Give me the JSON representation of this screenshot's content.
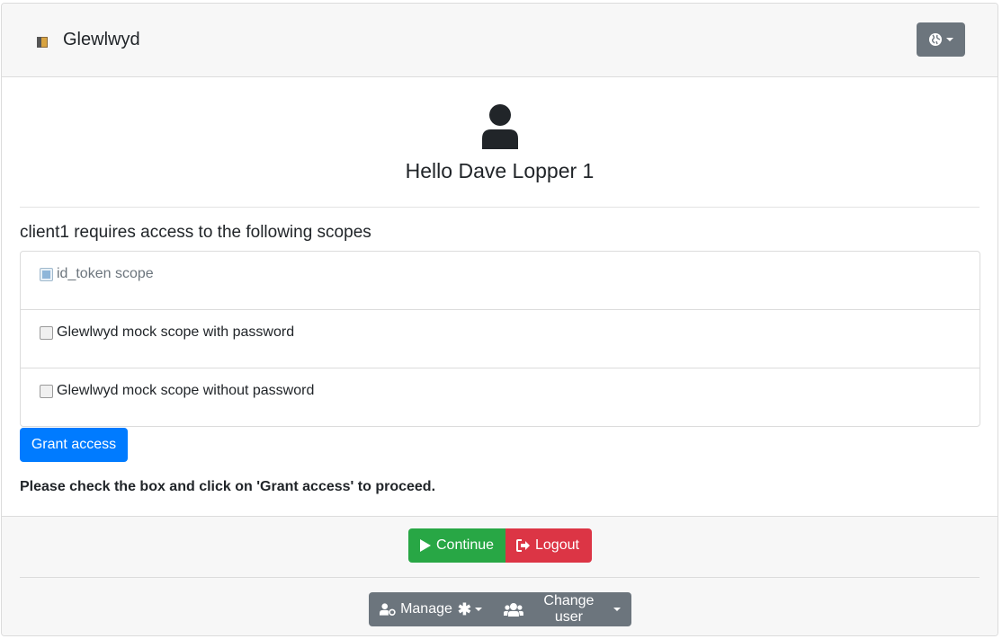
{
  "header": {
    "app_title": "Glewlwyd",
    "logo_icon": "door-icon",
    "language_button_icon": "globe-icon"
  },
  "user": {
    "icon": "user-icon",
    "greeting": "Hello Dave Lopper 1"
  },
  "scopes": {
    "title": "client1 requires access to the following scopes",
    "items": [
      {
        "label": "id_token scope",
        "checked": true,
        "disabled": true
      },
      {
        "label": "Glewlwyd mock scope with password",
        "checked": false,
        "disabled": false
      },
      {
        "label": "Glewlwyd mock scope without password",
        "checked": false,
        "disabled": false
      }
    ]
  },
  "actions": {
    "grant_label": "Grant access",
    "notice": "Please check the box and click on 'Grant access' to proceed."
  },
  "footer": {
    "continue_label": "Continue",
    "logout_label": "Logout",
    "manage_label": "Manage",
    "change_user_label": "Change user"
  },
  "colors": {
    "primary": "#007bff",
    "success": "#28a745",
    "danger": "#dc3545",
    "secondary": "#6c757d"
  }
}
